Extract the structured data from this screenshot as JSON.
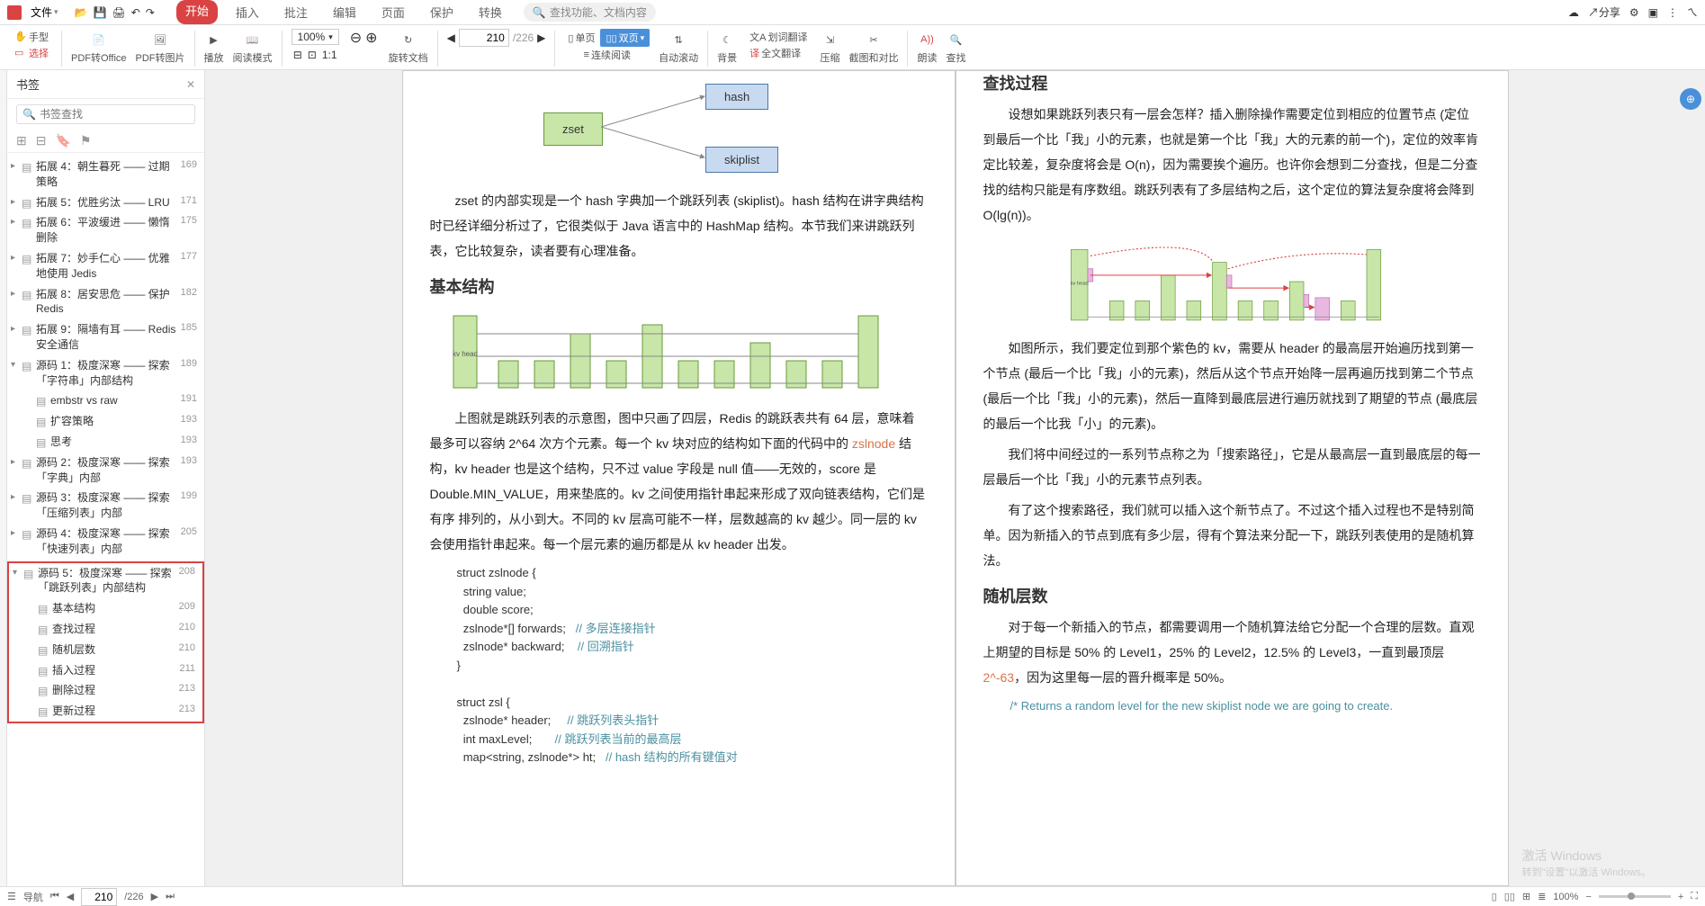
{
  "menubar": {
    "file_btn": "文件",
    "tabs": [
      "开始",
      "插入",
      "批注",
      "编辑",
      "页面",
      "保护",
      "转换"
    ],
    "active_tab": 0,
    "search_placeholder": "查找功能、文档内容",
    "share": "分享"
  },
  "ribbon": {
    "hand_tool": "手型",
    "select_tool": "选择",
    "pdf_office": "PDF转Office",
    "pdf_image": "PDF转图片",
    "play": "播放",
    "read_mode": "阅读模式",
    "zoom_value": "100%",
    "rotate": "旋转文档",
    "page_current": "210",
    "page_total": "/226",
    "single_page": "单页",
    "double_page": "双页",
    "continuous": "连续阅读",
    "auto_scroll": "自动滚动",
    "background": "背景",
    "word_translate": "划词翻译",
    "full_translate": "全文翻译",
    "compress": "压缩",
    "crop_compare": "截图和对比",
    "read_aloud": "朗读",
    "find": "查找"
  },
  "sidebar": {
    "title": "书签",
    "search_placeholder": "书签查找",
    "bookmarks": [
      {
        "label": "拓展 4：朝生暮死 —— 过期策略",
        "page": "169",
        "arrow": "▸",
        "indent": 0
      },
      {
        "label": "拓展 5：优胜劣汰 —— LRU",
        "page": "171",
        "arrow": "▸",
        "indent": 0
      },
      {
        "label": "拓展 6：平波缓进 —— 懒惰删除",
        "page": "175",
        "arrow": "▸",
        "indent": 0
      },
      {
        "label": "拓展 7：妙手仁心 —— 优雅地使用 Jedis",
        "page": "177",
        "arrow": "▸",
        "indent": 0
      },
      {
        "label": "拓展 8：居安思危 —— 保护 Redis",
        "page": "182",
        "arrow": "▸",
        "indent": 0
      },
      {
        "label": "拓展 9：隔墙有耳 —— Redis 安全通信",
        "page": "185",
        "arrow": "▸",
        "indent": 0
      },
      {
        "label": "源码 1：极度深寒 —— 探索「字符串」内部结构",
        "page": "189",
        "arrow": "▾",
        "indent": 0
      },
      {
        "label": "embstr vs raw",
        "page": "191",
        "arrow": "",
        "indent": 1
      },
      {
        "label": "扩容策略",
        "page": "193",
        "arrow": "",
        "indent": 1
      },
      {
        "label": "思考",
        "page": "193",
        "arrow": "",
        "indent": 1
      },
      {
        "label": "源码 2：极度深寒 —— 探索「字典」内部",
        "page": "193",
        "arrow": "▸",
        "indent": 0
      },
      {
        "label": "源码 3：极度深寒 —— 探索「压缩列表」内部",
        "page": "199",
        "arrow": "▸",
        "indent": 0
      },
      {
        "label": "源码 4：极度深寒 —— 探索「快速列表」内部",
        "page": "205",
        "arrow": "▸",
        "indent": 0
      }
    ],
    "highlighted": [
      {
        "label": "源码 5：极度深寒 —— 探索「跳跃列表」内部结构",
        "page": "208",
        "arrow": "▾",
        "indent": 0
      },
      {
        "label": "基本结构",
        "page": "209",
        "arrow": "",
        "indent": 1
      },
      {
        "label": "查找过程",
        "page": "210",
        "arrow": "",
        "indent": 1
      },
      {
        "label": "随机层数",
        "page": "210",
        "arrow": "",
        "indent": 1
      },
      {
        "label": "插入过程",
        "page": "211",
        "arrow": "",
        "indent": 1
      },
      {
        "label": "删除过程",
        "page": "213",
        "arrow": "",
        "indent": 1
      },
      {
        "label": "更新过程",
        "page": "213",
        "arrow": "",
        "indent": 1
      }
    ]
  },
  "doc": {
    "left_page": {
      "zset_label": "zset",
      "hash_label": "hash",
      "skiplist_label": "skiplist",
      "para1": "zset 的内部实现是一个 hash 字典加一个跳跃列表 (skiplist)。hash 结构在讲字典结构时已经详细分析过了，它很类似于 Java 语言中的 HashMap 结构。本节我们来讲跳跃列表，它比较复杂，读者要有心理准备。",
      "h1": "基本结构",
      "para2a": "上图就是跳跃列表的示意图，图中只画了四层，Redis 的跳跃表共有 64 层，意味着最多可以容纳 2^64 次方个元素。每一个 kv 块对应的结构如下面的代码中的 ",
      "para2_link": "zslnode",
      "para2b": " 结构，kv header 也是这个结构，只不过 value 字段是 null 值——无效的，score 是 Double.MIN_VALUE，用来垫底的。kv 之间使用指针串起来形成了双向链表结构，它们是有序 排列的，从小到大。不同的 kv 层高可能不一样，层数越高的 kv 越少。同一层的 kv 会使用指针串起来。每一个层元素的遍历都是从 kv header 出发。",
      "code1": "struct zslnode {\n  string value;\n  double score;\n  zslnode*[] forwards;   ",
      "code1_c1": "// 多层连接指针",
      "code1b": "\n  zslnode* backward;    ",
      "code1_c2": "// 回溯指针",
      "code1c": "\n}\n\nstruct zsl {\n  zslnode* header;     ",
      "code1_c3": "// 跳跃列表头指针",
      "code1d": "\n  int maxLevel;       ",
      "code1_c4": "// 跳跃列表当前的最高层",
      "code1e": "\n  map<string, zslnode*> ht;   ",
      "code1_c5": "// hash 结构的所有键值对",
      "kv_head": "kv\nhead"
    },
    "right_page": {
      "h_top": "查找过程",
      "para1": "设想如果跳跃列表只有一层会怎样？插入删除操作需要定位到相应的位置节点 (定位到最后一个比「我」小的元素，也就是第一个比「我」大的元素的前一个)，定位的效率肯定比较差，复杂度将会是 O(n)，因为需要挨个遍历。也许你会想到二分查找，但是二分查找的结构只能是有序数组。跳跃列表有了多层结构之后，这个定位的算法复杂度将会降到 O(lg(n))。",
      "para2": "如图所示，我们要定位到那个紫色的 kv，需要从 header 的最高层开始遍历找到第一个节点 (最后一个比「我」小的元素)，然后从这个节点开始降一层再遍历找到第二个节点 (最后一个比「我」小的元素)，然后一直降到最底层进行遍历就找到了期望的节点 (最底层的最后一个比我「小」的元素)。",
      "para3": "我们将中间经过的一系列节点称之为「搜索路径」，它是从最高层一直到最底层的每一层最后一个比「我」小的元素节点列表。",
      "para4": "有了这个搜索路径，我们就可以插入这个新节点了。不过这个插入过程也不是特别简单。因为新插入的节点到底有多少层，得有个算法来分配一下，跳跃列表使用的是随机算法。",
      "h2": "随机层数",
      "para5a": "对于每一个新插入的节点，都需要调用一个随机算法给它分配一个合理的层数。直观上期望的目标是 50% 的 Level1，25% 的 Level2，12.5% 的 Level3，一直到最顶层 ",
      "para5_link": "2^-63",
      "para5b": "，因为这里每一层的晋升概率是 50%。",
      "code_comment": "/* Returns a random level for the new skiplist node we are going to create.",
      "kv_head": "kv\nhead"
    }
  },
  "statusbar": {
    "nav_label": "导航",
    "page_current": "210",
    "page_total": "/226",
    "zoom_value": "100%"
  },
  "watermark": {
    "title": "激活 Windows",
    "sub": "转到\"设置\"以激活 Windows。"
  }
}
